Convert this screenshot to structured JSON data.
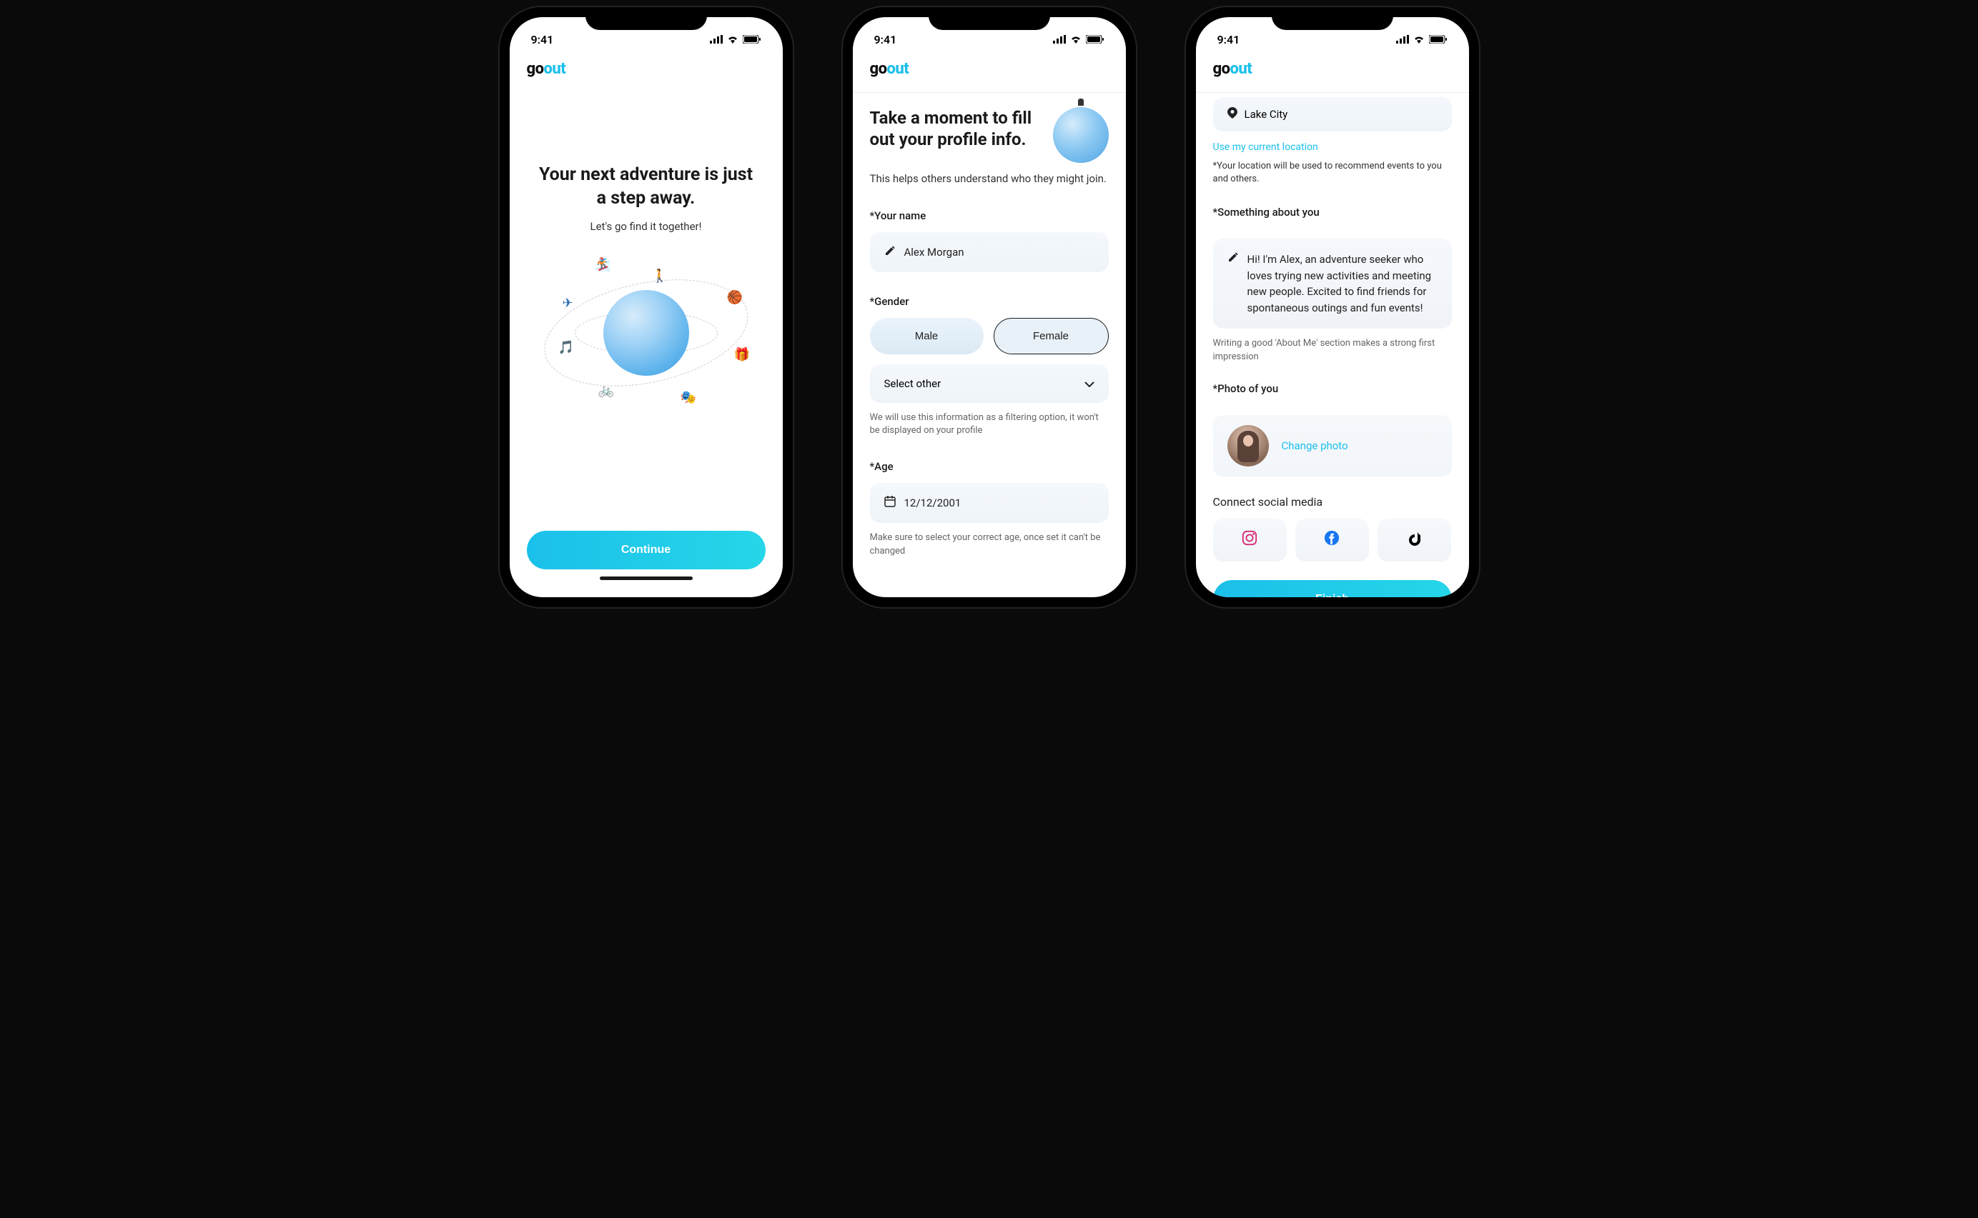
{
  "status": {
    "time": "9:41"
  },
  "brand": {
    "part1": "go",
    "part2": "out"
  },
  "screen1": {
    "title": "Your next adventure is just a step away.",
    "subtitle": "Let's go find it together!",
    "cta": "Continue"
  },
  "screen2": {
    "title": "Take a moment to fill out your profile info.",
    "subtitle": "This helps others understand who they might join.",
    "name_label": "*Your name",
    "name_value": "Alex Morgan",
    "gender_label": "*Gender",
    "gender_male": "Male",
    "gender_female": "Female",
    "gender_other": "Select other",
    "gender_helper": "We will use this information as a filtering option, it won't be displayed on your profile",
    "age_label": "*Age",
    "age_value": "12/12/2001",
    "age_helper": "Make sure to select your correct age, once set it can't be changed"
  },
  "screen3": {
    "location_value": "Lake City",
    "use_location": "Use my current location",
    "location_hint": "*Your location will be used to recommend events to you and others.",
    "about_label": "*Something about you",
    "about_value": "Hi! I'm Alex, an adventure seeker who loves trying new activities and meeting new people. Excited to find friends for spontaneous outings and fun events!",
    "about_hint": "Writing a good 'About Me' section makes a strong first impression",
    "photo_label": "*Photo of you",
    "change_photo": "Change photo",
    "social_label": "Connect social media",
    "cta": "Finish"
  }
}
